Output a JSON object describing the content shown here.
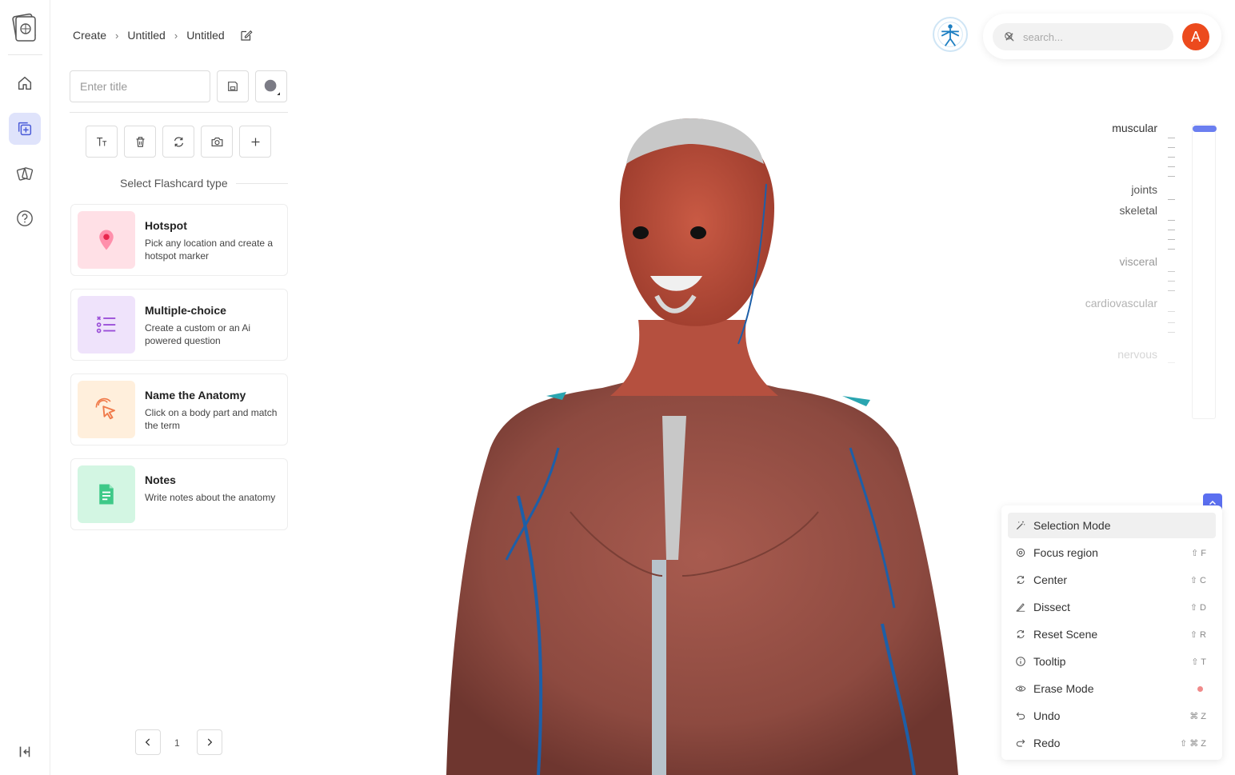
{
  "breadcrumb": [
    "Create",
    "Untitled",
    "Untitled"
  ],
  "title_input": {
    "placeholder": "Enter title"
  },
  "select_label": "Select Flashcard type",
  "cards": [
    {
      "title": "Hotspot",
      "desc": "Pick any location and create a hotspot marker",
      "color": "#ffe0e6",
      "icon": "location-pin-icon"
    },
    {
      "title": "Multiple-choice",
      "desc": "Create a custom or an Ai powered question",
      "color": "#efe3fb",
      "icon": "checklist-icon"
    },
    {
      "title": "Name the Anatomy",
      "desc": "Click on a body part and match the term",
      "color": "#ffefdc",
      "icon": "pointer-click-icon"
    },
    {
      "title": "Notes",
      "desc": "Write notes about the anatomy",
      "color": "#d3f6e3",
      "icon": "document-icon"
    }
  ],
  "pager": {
    "page": "1"
  },
  "search": {
    "placeholder": "search..."
  },
  "avatar": {
    "letter": "A",
    "color": "#ec4a1d"
  },
  "layers": [
    {
      "label": "muscular",
      "color": "#333333"
    },
    {
      "label": "joints",
      "color": "#555555"
    },
    {
      "label": "skeletal",
      "color": "#555555"
    },
    {
      "label": "visceral",
      "color": "#999999"
    },
    {
      "label": "cardiovascular",
      "color": "#b3b3b3"
    },
    {
      "label": "nervous",
      "color": "#d6d6d6"
    }
  ],
  "menu": [
    {
      "label": "Selection Mode",
      "shortcut": "",
      "icon": "magic-wand-icon"
    },
    {
      "label": "Focus region",
      "shortcut": "⇧ F",
      "icon": "target-icon"
    },
    {
      "label": "Center",
      "shortcut": "⇧ C",
      "icon": "rotate-icon"
    },
    {
      "label": "Dissect",
      "shortcut": "⇧ D",
      "icon": "scalpel-icon"
    },
    {
      "label": "Reset Scene",
      "shortcut": "⇧ R",
      "icon": "reset-icon"
    },
    {
      "label": "Tooltip",
      "shortcut": "⇧ T",
      "icon": "info-icon"
    },
    {
      "label": "Erase Mode",
      "shortcut": "",
      "icon": "eye-icon"
    },
    {
      "label": "Undo",
      "shortcut": "⌘ Z",
      "icon": "undo-icon"
    },
    {
      "label": "Redo",
      "shortcut": "⇧ ⌘ Z",
      "icon": "redo-icon"
    }
  ],
  "accent": "#5b6ff0"
}
